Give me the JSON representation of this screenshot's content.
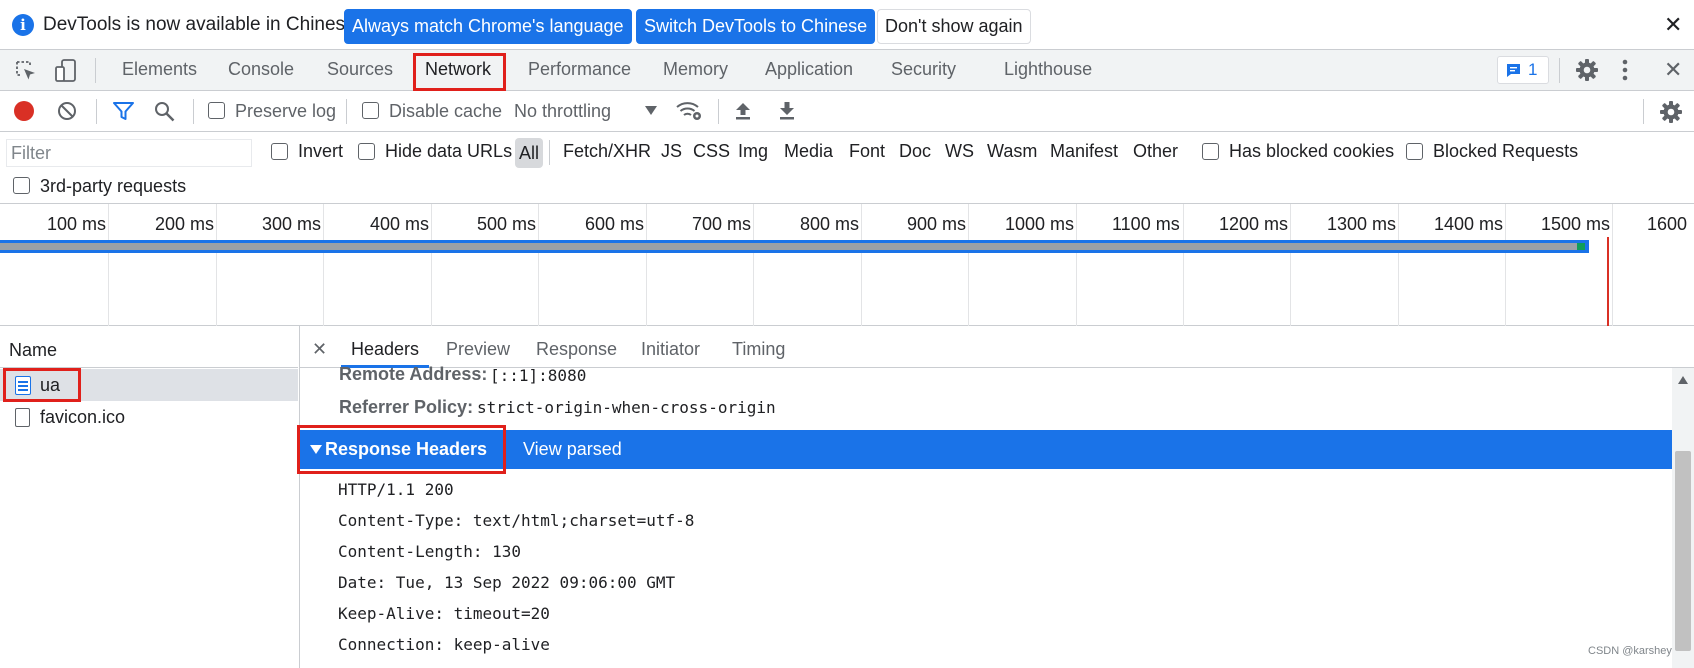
{
  "infobar": {
    "message": "DevTools is now available in Chinese!",
    "btn_match": "Always match Chrome's language",
    "btn_switch": "Switch DevTools to Chinese",
    "btn_dismiss": "Don't show again",
    "close": "✕",
    "info_icon": "i"
  },
  "tabs": [
    "Elements",
    "Console",
    "Sources",
    "Network",
    "Performance",
    "Memory",
    "Application",
    "Security",
    "Lighthouse"
  ],
  "active_tab": "Network",
  "issues_badge": "1",
  "net_toolbar": {
    "preserve_log": "Preserve log",
    "disable_cache": "Disable cache",
    "throttling": "No throttling"
  },
  "filter": {
    "placeholder": "Filter",
    "invert": "Invert",
    "hide_data_urls": "Hide data URLs",
    "types": [
      "All",
      "Fetch/XHR",
      "JS",
      "CSS",
      "Img",
      "Media",
      "Font",
      "Doc",
      "WS",
      "Wasm",
      "Manifest",
      "Other"
    ],
    "has_blocked_cookies": "Has blocked cookies",
    "blocked_requests": "Blocked Requests",
    "third_party": "3rd-party requests"
  },
  "timeline_ticks": [
    "100 ms",
    "200 ms",
    "300 ms",
    "400 ms",
    "500 ms",
    "600 ms",
    "700 ms",
    "800 ms",
    "900 ms",
    "1000 ms",
    "1100 ms",
    "1200 ms",
    "1300 ms",
    "1400 ms",
    "1500 ms",
    "1600"
  ],
  "requests": {
    "header": "Name",
    "items": [
      "ua",
      "favicon.ico"
    ]
  },
  "detail": {
    "close": "✕",
    "tabs": [
      "Headers",
      "Preview",
      "Response",
      "Initiator",
      "Timing"
    ],
    "general": [
      {
        "key": "Remote Address:",
        "value": "[::1]:8080"
      },
      {
        "key": "Referrer Policy:",
        "value": "strict-origin-when-cross-origin"
      }
    ],
    "section_title": "Response Headers",
    "section_link": "View parsed",
    "raw_headers": [
      "HTTP/1.1 200",
      "Content-Type: text/html;charset=utf-8",
      "Content-Length: 130",
      "Date: Tue, 13 Sep 2022 09:06:00 GMT",
      "Keep-Alive: timeout=20",
      "Connection: keep-alive"
    ]
  },
  "watermark": "CSDN @karshey",
  "colors": {
    "accent": "#1a73e8",
    "highlight": "#e0201b",
    "record": "#d93025"
  }
}
